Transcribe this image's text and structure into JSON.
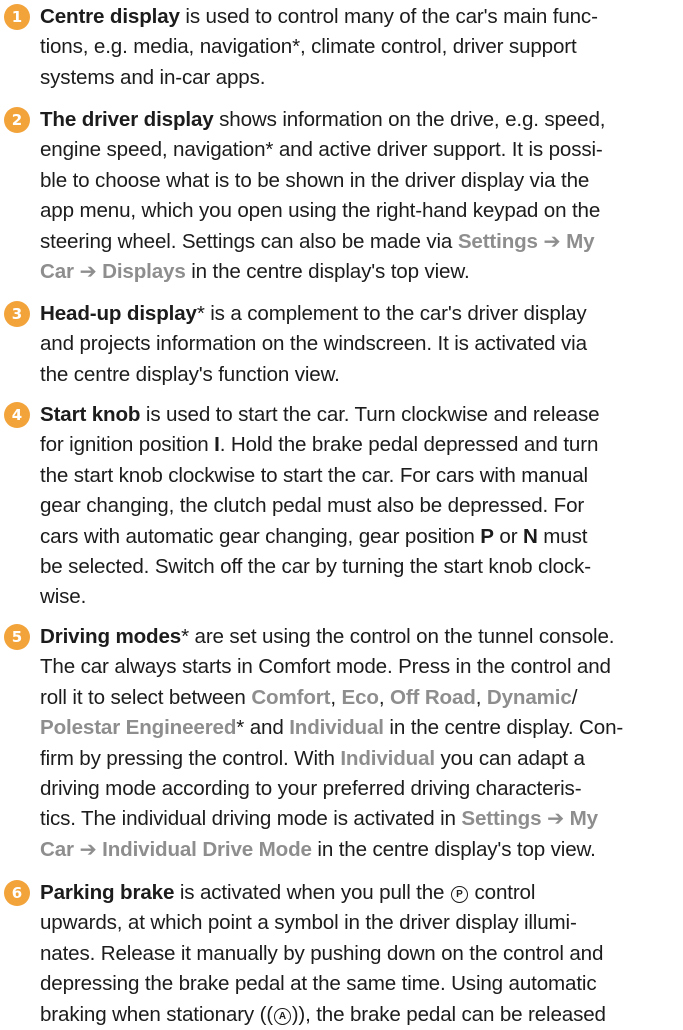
{
  "items": [
    {
      "number": "1",
      "lines": [
        [
          {
            "s": "b",
            "t": "Centre display"
          },
          {
            "s": "n",
            "t": " is used to control many of the car's main func-"
          }
        ],
        [
          {
            "s": "n",
            "t": "tions, e.g. media, navigation*, climate control, driver support"
          }
        ],
        [
          {
            "s": "n",
            "t": "systems and in-car apps."
          }
        ]
      ]
    },
    {
      "number": "2",
      "lines": [
        [
          {
            "s": "b",
            "t": "The driver display"
          },
          {
            "s": "n",
            "t": " shows information on the drive, e.g. speed,"
          }
        ],
        [
          {
            "s": "n",
            "t": "engine speed, navigation* and active driver support. It is possi-"
          }
        ],
        [
          {
            "s": "n",
            "t": "ble to choose what is to be shown in the driver display via the"
          }
        ],
        [
          {
            "s": "n",
            "t": "app menu, which you open using the right-hand keypad on the"
          }
        ],
        [
          {
            "s": "n",
            "t": "steering wheel. Settings can also be made via "
          },
          {
            "s": "m",
            "t": "Settings ➔ My"
          }
        ],
        [
          {
            "s": "m",
            "t": "Car ➔ Displays"
          },
          {
            "s": "n",
            "t": " in the centre display's top view."
          }
        ]
      ]
    },
    {
      "number": "3",
      "lines": [
        [
          {
            "s": "b",
            "t": "Head-up display"
          },
          {
            "s": "n",
            "t": "* is a complement to the car's driver display"
          }
        ],
        [
          {
            "s": "n",
            "t": "and projects information on the windscreen. It is activated via"
          }
        ],
        [
          {
            "s": "n",
            "t": "the centre display's function view."
          }
        ]
      ]
    },
    {
      "number": "4",
      "lines": [
        [
          {
            "s": "b",
            "t": "Start knob"
          },
          {
            "s": "n",
            "t": " is used to start the car. Turn clockwise and release"
          }
        ],
        [
          {
            "s": "n",
            "t": "for ignition position "
          },
          {
            "s": "b",
            "t": "I"
          },
          {
            "s": "n",
            "t": ". Hold the brake pedal depressed and turn"
          }
        ],
        [
          {
            "s": "n",
            "t": "the start knob clockwise to start the car. For cars with manual"
          }
        ],
        [
          {
            "s": "n",
            "t": "gear changing, the clutch pedal must also be depressed. For"
          }
        ],
        [
          {
            "s": "n",
            "t": "cars with automatic gear changing, gear position "
          },
          {
            "s": "b",
            "t": "P"
          },
          {
            "s": "n",
            "t": " or "
          },
          {
            "s": "b",
            "t": "N"
          },
          {
            "s": "n",
            "t": " must"
          }
        ],
        [
          {
            "s": "n",
            "t": "be selected. Switch off the car by turning the start knob clock-"
          }
        ],
        [
          {
            "s": "n",
            "t": "wise."
          }
        ]
      ]
    },
    {
      "number": "5",
      "lines": [
        [
          {
            "s": "b",
            "t": "Driving modes"
          },
          {
            "s": "n",
            "t": "* are set using the control on the tunnel console."
          }
        ],
        [
          {
            "s": "n",
            "t": "The car always starts in Comfort mode. Press in the control and"
          }
        ],
        [
          {
            "s": "n",
            "t": "roll it to select between "
          },
          {
            "s": "m",
            "t": "Comfort"
          },
          {
            "s": "n",
            "t": ", "
          },
          {
            "s": "m",
            "t": "Eco"
          },
          {
            "s": "n",
            "t": ", "
          },
          {
            "s": "m",
            "t": "Off Road"
          },
          {
            "s": "n",
            "t": ", "
          },
          {
            "s": "m",
            "t": "Dynamic"
          },
          {
            "s": "n",
            "t": "/"
          }
        ],
        [
          {
            "s": "m",
            "t": "Polestar Engineered"
          },
          {
            "s": "n",
            "t": "* and "
          },
          {
            "s": "m",
            "t": "Individual"
          },
          {
            "s": "n",
            "t": " in the centre display. Con-"
          }
        ],
        [
          {
            "s": "n",
            "t": "firm by pressing the control. With "
          },
          {
            "s": "m",
            "t": "Individual"
          },
          {
            "s": "n",
            "t": " you can adapt a"
          }
        ],
        [
          {
            "s": "n",
            "t": "driving mode according to your preferred driving characteris-"
          }
        ],
        [
          {
            "s": "n",
            "t": "tics. The individual driving mode is activated in "
          },
          {
            "s": "m",
            "t": "Settings ➔ My"
          }
        ],
        [
          {
            "s": "m",
            "t": "Car ➔ Individual Drive Mode"
          },
          {
            "s": "n",
            "t": " in the centre display's top view."
          }
        ]
      ]
    },
    {
      "number": "6",
      "lines": [
        [
          {
            "s": "b",
            "t": "Parking brake"
          },
          {
            "s": "n",
            "t": " is activated when you pull the "
          },
          {
            "s": "sym",
            "t": "P"
          },
          {
            "s": "n",
            "t": " control"
          }
        ],
        [
          {
            "s": "n",
            "t": "upwards, at which point a symbol in the driver display illumi-"
          }
        ],
        [
          {
            "s": "n",
            "t": "nates. Release it manually by pushing down on the control and"
          }
        ],
        [
          {
            "s": "n",
            "t": "depressing the brake pedal at the same time. Using automatic"
          }
        ],
        [
          {
            "s": "n",
            "t": "braking when stationary ("
          },
          {
            "s": "symp",
            "t": "A"
          },
          {
            "s": "n",
            "t": "), the brake pedal can be released"
          }
        ]
      ]
    }
  ]
}
